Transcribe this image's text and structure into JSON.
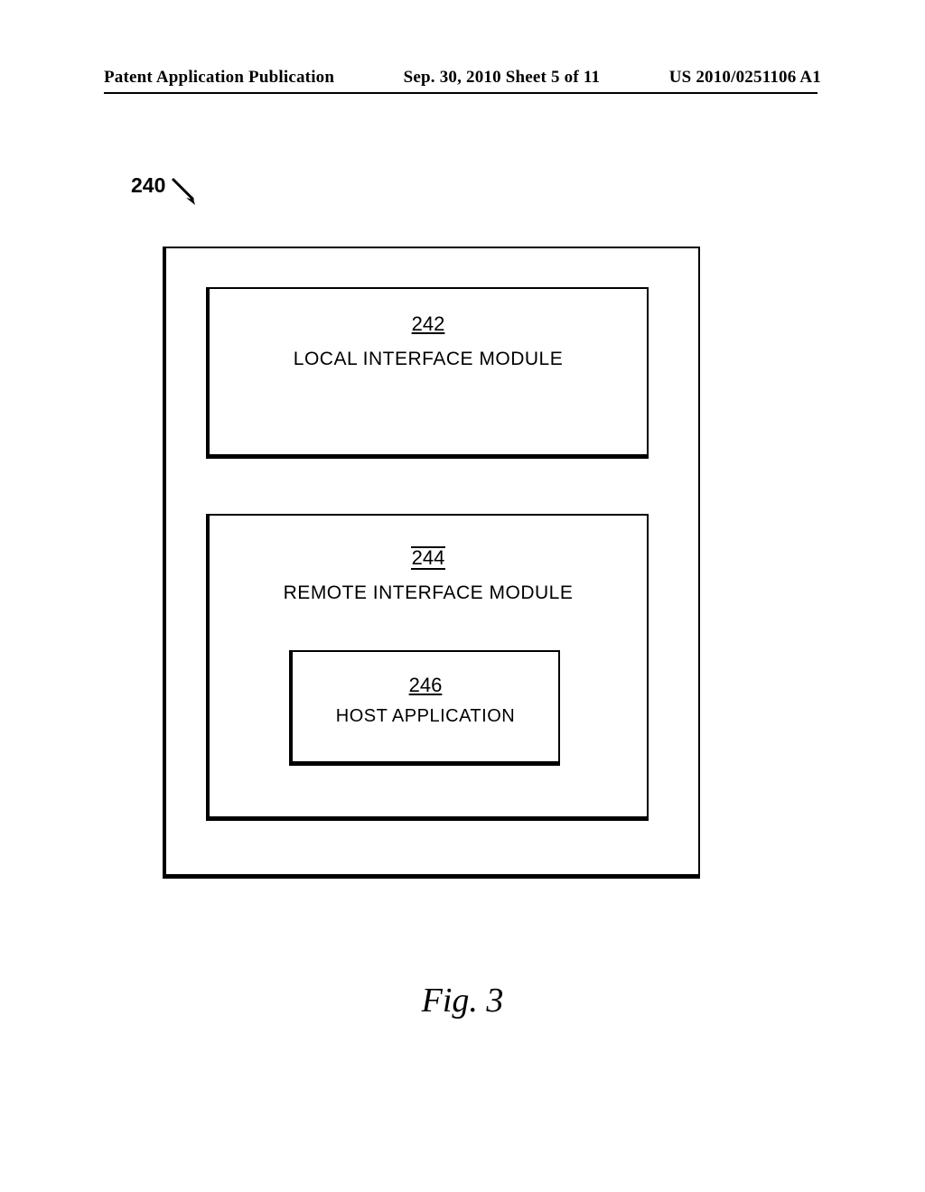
{
  "header": {
    "left": "Patent Application Publication",
    "center": "Sep. 30, 2010  Sheet 5 of 11",
    "right": "US 2010/0251106 A1"
  },
  "figure": {
    "ref": "240",
    "caption": "Fig. 3"
  },
  "modules": {
    "local": {
      "ref": "242",
      "label": "LOCAL INTERFACE MODULE"
    },
    "remote": {
      "ref": "244",
      "label": "REMOTE INTERFACE MODULE"
    },
    "host": {
      "ref": "246",
      "label": "HOST APPLICATION"
    }
  }
}
